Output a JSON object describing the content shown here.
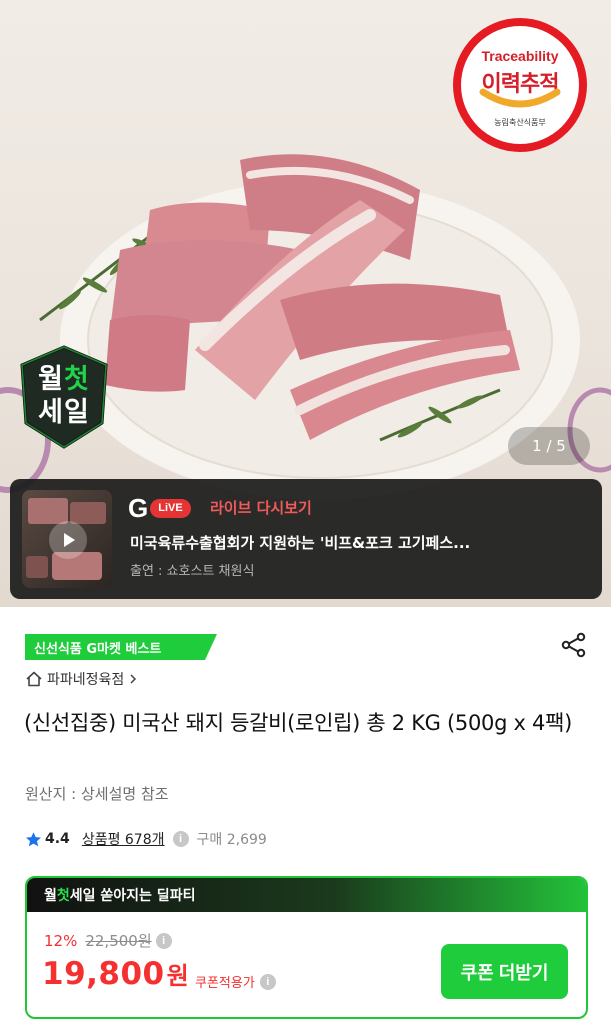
{
  "hero": {
    "traceability": {
      "en": "Traceability",
      "ko": "이력추적",
      "ministry": "농림축산식품부"
    },
    "monthly_sale_badge": {
      "line1_a": "월",
      "line1_b": "첫",
      "line2": "세일"
    },
    "page_indicator": "1 / 5"
  },
  "live": {
    "g_letter": "G",
    "live_pill": "LiVE",
    "label": "라이브 다시보기",
    "title": "미국육류수출협회가 지원하는 '비프&포크 고기페스...",
    "host": "출연 : 쇼호스트 채원식"
  },
  "product": {
    "best_tag": "신선식품 G마켓 베스트",
    "store": "파파네정육점",
    "title": "(신선집중) 미국산 돼지 등갈비(로인립) 총 2 KG (500g x 4팩)",
    "origin": "원산지 : 상세설명 참조",
    "rating": "4.4",
    "reviews": "상품평 678개",
    "purchases": "구매 2,699"
  },
  "deal": {
    "header_a": "월",
    "header_b": "첫",
    "header_c": "세일 쏟아지는 딜파티",
    "discount_pct": "12%",
    "original_price": "22,500원",
    "price": "19,800",
    "price_unit": "원",
    "coupon_note": "쿠폰적용가",
    "coupon_button": "쿠폰 더받기"
  },
  "colors": {
    "accent_green": "#1fcc3b",
    "sale_red": "#f43030",
    "trace_red": "#e51b24",
    "star_blue": "#1e73e8"
  }
}
